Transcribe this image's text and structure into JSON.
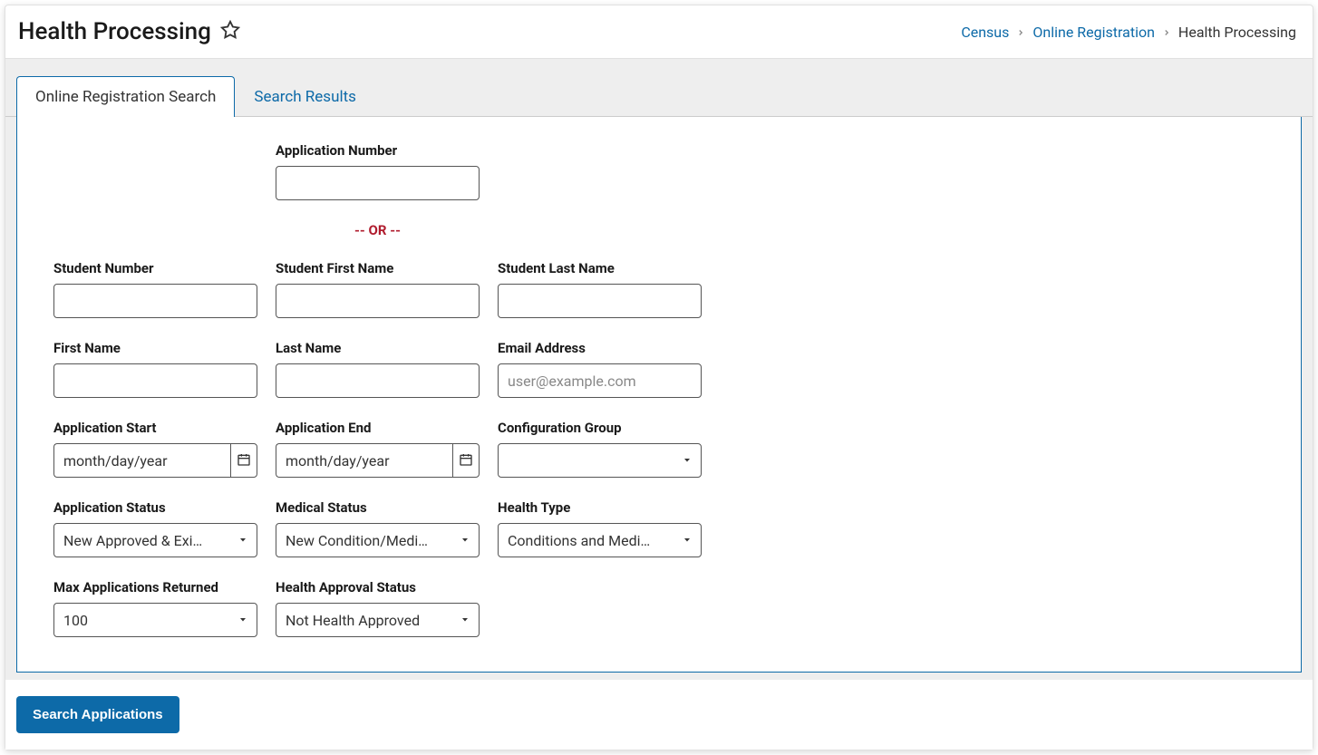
{
  "header": {
    "title": "Health Processing"
  },
  "breadcrumb": {
    "items": [
      {
        "label": "Census",
        "link": true
      },
      {
        "label": "Online Registration",
        "link": true
      },
      {
        "label": "Health Processing",
        "link": false
      }
    ]
  },
  "tabs": {
    "items": [
      {
        "label": "Online Registration Search",
        "active": true
      },
      {
        "label": "Search Results",
        "active": false
      }
    ]
  },
  "form": {
    "application_number": {
      "label": "Application Number",
      "value": ""
    },
    "or_divider": "-- OR --",
    "student_number": {
      "label": "Student Number",
      "value": ""
    },
    "student_first_name": {
      "label": "Student First Name",
      "value": ""
    },
    "student_last_name": {
      "label": "Student Last Name",
      "value": ""
    },
    "first_name": {
      "label": "First Name",
      "value": ""
    },
    "last_name": {
      "label": "Last Name",
      "value": ""
    },
    "email": {
      "label": "Email Address",
      "value": "",
      "placeholder": "user@example.com"
    },
    "application_start": {
      "label": "Application Start",
      "value": "month/day/year"
    },
    "application_end": {
      "label": "Application End",
      "value": "month/day/year"
    },
    "configuration_group": {
      "label": "Configuration Group",
      "value": ""
    },
    "application_status": {
      "label": "Application Status",
      "value": "New Approved & Exi…"
    },
    "medical_status": {
      "label": "Medical Status",
      "value": "New Condition/Medi…"
    },
    "health_type": {
      "label": "Health Type",
      "value": "Conditions and Medi…"
    },
    "max_applications": {
      "label": "Max Applications Returned",
      "value": "100"
    },
    "health_approval_status": {
      "label": "Health Approval Status",
      "value": "Not Health Approved"
    }
  },
  "buttons": {
    "search": "Search Applications"
  }
}
